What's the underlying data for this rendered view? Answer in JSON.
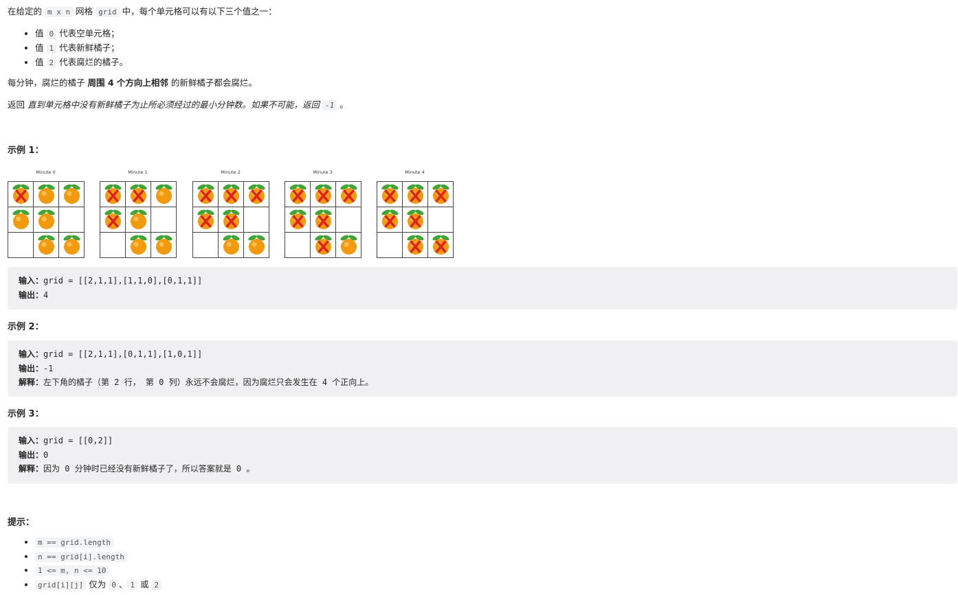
{
  "intro": {
    "pre": "在给定的",
    "code_mxn": "m x n",
    "mid": "网格",
    "code_grid": "grid",
    "post": "中，每个单元格可以有以下三个值之一："
  },
  "rules": [
    {
      "pre": "值",
      "code": "0",
      "post": "代表空单元格；"
    },
    {
      "pre": "值",
      "code": "1",
      "post": "代表新鲜橘子；"
    },
    {
      "pre": "值",
      "code": "2",
      "post": "代表腐烂的橘子。"
    }
  ],
  "spread": {
    "pre": "每分钟，腐烂的橘子",
    "bold": "周围 4 个方向上相邻",
    "post": "的新鲜橘子都会腐烂。"
  },
  "ret": {
    "pre": "返回",
    "em": "直到单元格中没有新鲜橘子为止所必须经过的最小分钟数。如果不可能，返回",
    "code": "-1",
    "post": "。"
  },
  "example1": {
    "title": "示例 1：",
    "figure": {
      "panels": [
        {
          "label": "Minute 0",
          "grid": [
            [
              2,
              1,
              1
            ],
            [
              1,
              1,
              0
            ],
            [
              0,
              1,
              1
            ]
          ]
        },
        {
          "label": "Minute 1",
          "grid": [
            [
              2,
              2,
              1
            ],
            [
              2,
              1,
              0
            ],
            [
              0,
              1,
              1
            ]
          ]
        },
        {
          "label": "Minute 2",
          "grid": [
            [
              2,
              2,
              2
            ],
            [
              2,
              2,
              0
            ],
            [
              0,
              1,
              1
            ]
          ]
        },
        {
          "label": "Minute 3",
          "grid": [
            [
              2,
              2,
              2
            ],
            [
              2,
              2,
              0
            ],
            [
              0,
              2,
              1
            ]
          ]
        },
        {
          "label": "Minute 4",
          "grid": [
            [
              2,
              2,
              2
            ],
            [
              2,
              2,
              0
            ],
            [
              0,
              2,
              2
            ]
          ]
        }
      ]
    },
    "input_label": "输入：",
    "input": "grid = [[2,1,1],[1,1,0],[0,1,1]]",
    "output_label": "输出：",
    "output": "4"
  },
  "example2": {
    "title": "示例 2：",
    "input_label": "输入：",
    "input": "grid = [[2,1,1],[0,1,1],[1,0,1]]",
    "output_label": "输出：",
    "output": "-1",
    "explain_label": "解释：",
    "explain": "左下角的橘子（第 2 行， 第 0 列）永远不会腐烂，因为腐烂只会发生在 4 个正向上。"
  },
  "example3": {
    "title": "示例 3：",
    "input_label": "输入：",
    "input": "grid = [[0,2]]",
    "output_label": "输出：",
    "output": "0",
    "explain_label": "解释：",
    "explain": "因为 0 分钟时已经没有新鲜橘子了，所以答案就是 0 。"
  },
  "hints": {
    "title": "提示：",
    "items": [
      {
        "code": "m == grid.length",
        "text": ""
      },
      {
        "code": "n == grid[i].length",
        "text": ""
      },
      {
        "code": "1 <= m, n <= 10",
        "text": ""
      },
      {
        "code": "grid[i][j]",
        "text": "仅为",
        "c0": "0",
        "sep": "、",
        "c1": "1",
        "or": "或",
        "c2": "2"
      }
    ]
  },
  "colors": {
    "orange": "#f39a0c",
    "leaf": "#3fa535",
    "x_mark": "#e0201c",
    "code_bg": "#f2f3f5",
    "pre_bg": "#f0f0f2"
  }
}
